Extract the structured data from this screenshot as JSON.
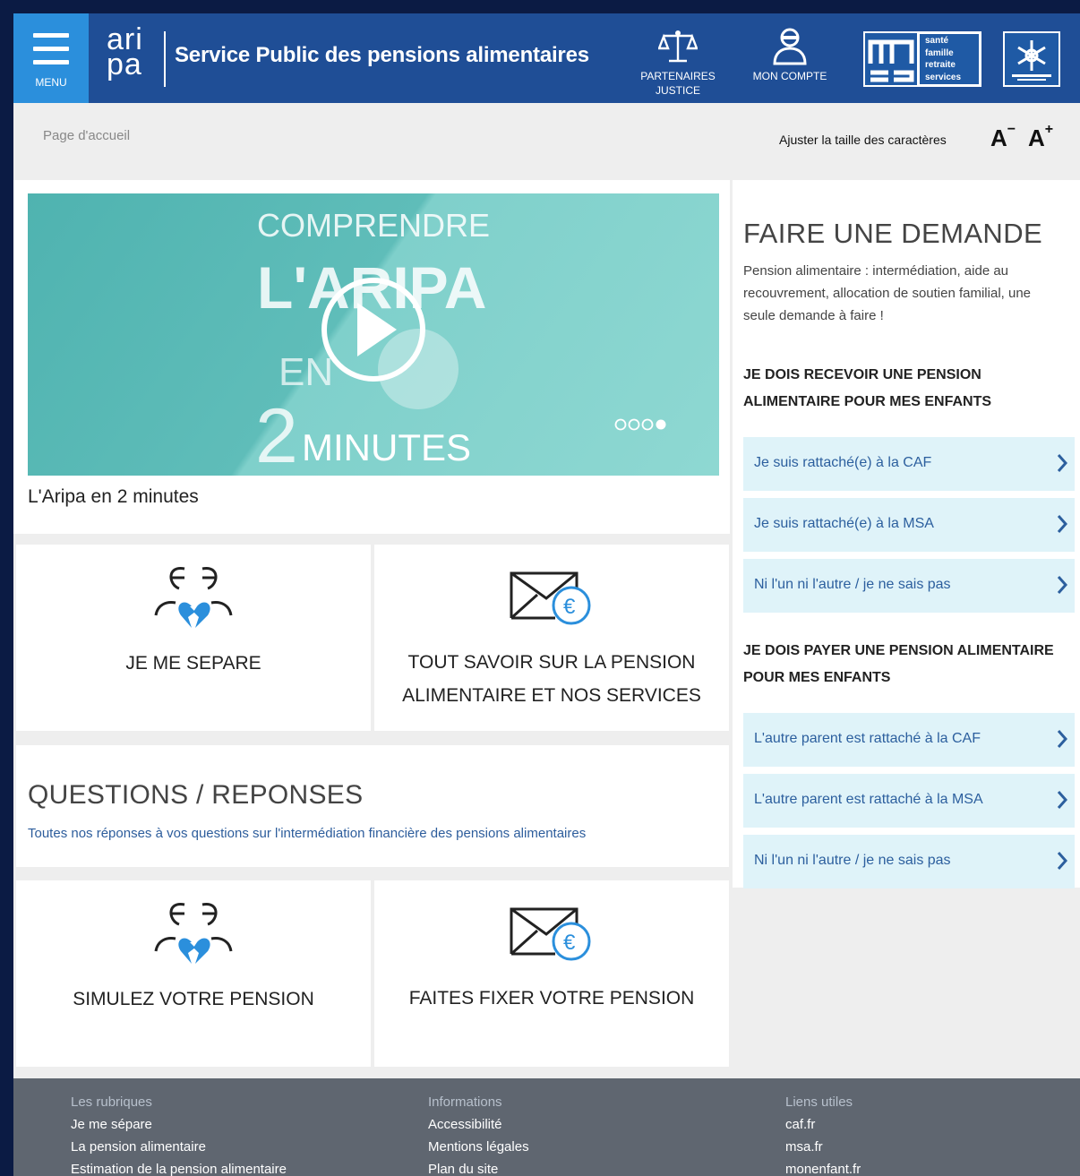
{
  "header": {
    "menu_label": "MENU",
    "logo_text_top": "ari",
    "logo_text_bottom": "pa",
    "site_title": "Service Public des pensions alimentaires",
    "justice_label_line1": "PARTENAIRES",
    "justice_label_line2": "JUSTICE",
    "account_label": "MON COMPTE",
    "msa_lines": [
      "santé",
      "famille",
      "retraite",
      "services"
    ]
  },
  "subbar": {
    "breadcrumb": "Page d'accueil",
    "font_adjust_label": "Ajuster la taille des caractères",
    "font_decrease": "A",
    "font_decrease_sup": "−",
    "font_increase": "A",
    "font_increase_sup": "+"
  },
  "video": {
    "line1": "COMPRENDRE",
    "line2": "L'ARIPA",
    "line3": "EN",
    "line4_num": "2",
    "line4_word": "MINUTES",
    "caption": "L'Aripa en 2 minutes",
    "carousel_total": 4,
    "carousel_active": 4
  },
  "tiles": {
    "separe": {
      "line1": "JE ME SEPARE",
      "line2": ""
    },
    "pension": {
      "line1": "TOUT SAVOIR SUR LA PENSION",
      "line2": "ALIMENTAIRE ET NOS SERVICES"
    },
    "simulez": {
      "line1": "SIMULEZ VOTRE PENSION",
      "line2": ""
    },
    "fixer": {
      "line1": "FAITES FIXER VOTRE PENSION",
      "line2": ""
    }
  },
  "faq": {
    "title": "QUESTIONS / REPONSES",
    "subtitle": "Toutes nos réponses à vos questions sur l'intermédiation financière des pensions alimentaires"
  },
  "request": {
    "title": "FAIRE UNE DEMANDE",
    "description": "Pension alimentaire : intermédiation, aide au recouvrement, allocation de soutien familial, une seule demande à faire !",
    "receive_title_line1": "JE DOIS RECEVOIR UNE PENSION",
    "receive_title_line2": "ALIMENTAIRE POUR MES ENFANTS",
    "receive_options": [
      "Je suis rattaché(e) à la CAF",
      "Je suis rattaché(e) à la MSA",
      "Ni l'un ni l'autre / je ne sais pas"
    ],
    "pay_title_line1": "JE DOIS PAYER UNE PENSION ALIMENTAIRE",
    "pay_title_line2": "POUR MES ENFANTS",
    "pay_options": [
      "L'autre parent est rattaché à la CAF",
      "L'autre parent est rattaché à la MSA",
      "Ni l'un ni l'autre / je ne sais pas"
    ]
  },
  "footer": {
    "col1": {
      "head": "Les rubriques",
      "links": [
        "Je me sépare",
        "La pension alimentaire",
        "Estimation de la pension alimentaire"
      ]
    },
    "col2": {
      "head": "Informations",
      "links": [
        "Accessibilité",
        "Mentions légales",
        "Plan du site"
      ]
    },
    "col3": {
      "head": "Liens utiles",
      "links": [
        "caf.fr",
        "msa.fr",
        "monenfant.fr"
      ]
    }
  },
  "colors": {
    "header_bg": "#1f4e96",
    "menu_bg": "#2b8fdc",
    "choice_bg": "#dff3f9",
    "choice_text": "#2c5f9e",
    "icon_blue": "#2b8fdc",
    "footer_bg": "#5f6670"
  },
  "icons": {
    "justice": "scales-icon",
    "account": "user-icon",
    "separation": "broken-heart-couple-icon",
    "pension": "envelope-euro-icon",
    "video": "play-icon",
    "chevron": "chevron-right-icon"
  }
}
